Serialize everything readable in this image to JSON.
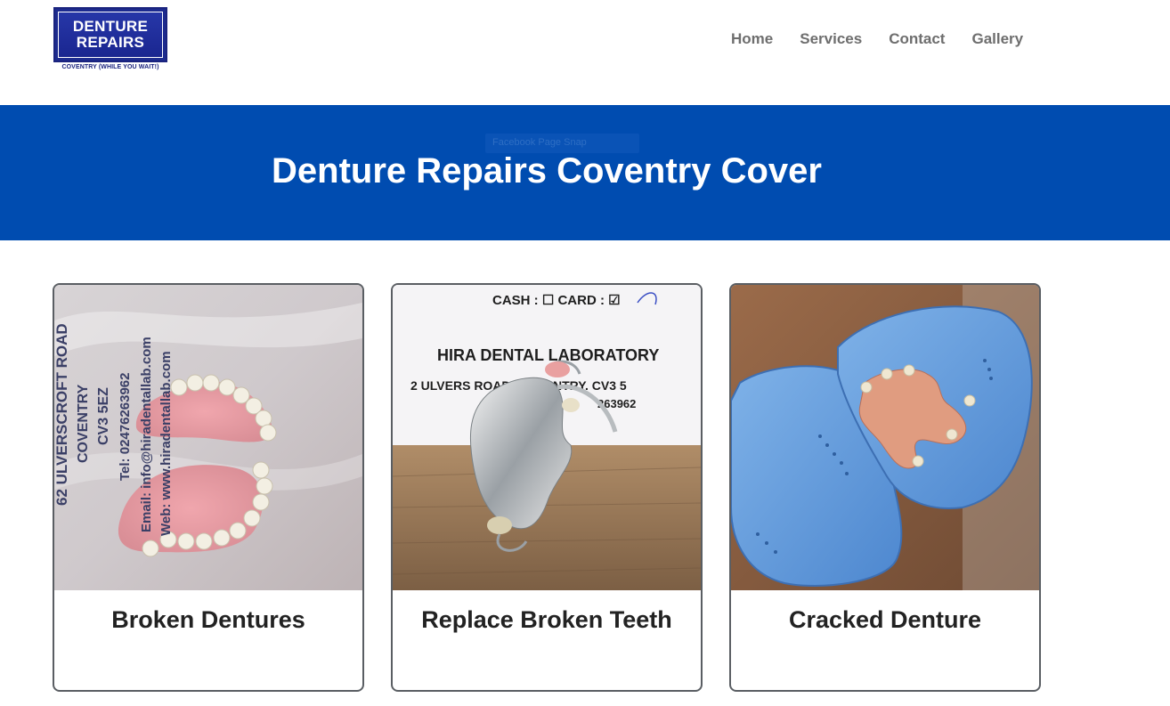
{
  "logo": {
    "line1": "DENTURE",
    "line2": "REPAIRS",
    "sub": "COVENTRY (WHILE YOU WAIT!)"
  },
  "nav": {
    "items": [
      "Home",
      "Services",
      "Contact",
      "Gallery"
    ]
  },
  "banner": {
    "title": "Denture Repairs Coventry Cover",
    "ghost_text": "Facebook Page Snap"
  },
  "cards": [
    {
      "title": "Broken Dentures",
      "image_text": {
        "l1": "62 ULVERSCROFT ROAD",
        "l2": "COVENTRY",
        "l3": "CV3 5EZ",
        "l4": "Tel: 02476263962",
        "l5": "Email: info@hiradentallab.com",
        "l6": "Web: www.hiradentallab.com"
      }
    },
    {
      "title": "Replace Broken Teeth",
      "image_text": {
        "l1": "CASH : ☐ CARD : ☑",
        "l2": "HIRA DENTAL LABORATORY",
        "l3": "2 ULVERS      ROAD, COVENTRY. CV3 5",
        "l4": "263962"
      }
    },
    {
      "title": "Cracked Denture",
      "image_text": {}
    }
  ],
  "colors": {
    "banner": "#004cb0",
    "nav_text": "#6e6e6e",
    "card_border": "#5a5e63",
    "logo_blue": "#1d2b8f"
  }
}
